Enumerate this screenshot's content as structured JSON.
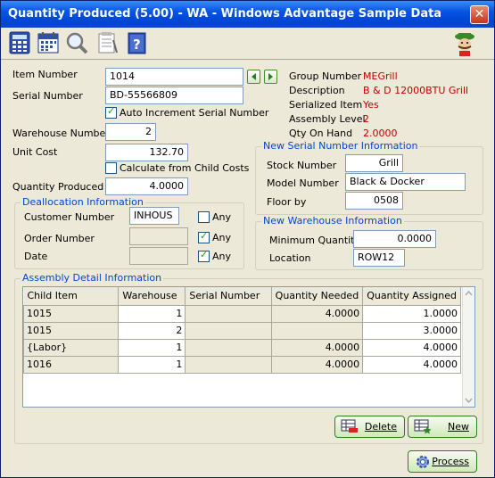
{
  "window": {
    "title": "Quantity Produced (5.00) - WA - Windows Advantage Sample Data",
    "close_glyph": "✕"
  },
  "toolbar": {
    "icons": [
      "calculator-icon",
      "calendar-icon",
      "search-icon",
      "notes-icon",
      "help-icon",
      "mascot-icon"
    ]
  },
  "form": {
    "item_number_label": "Item Number",
    "item_number": "1014",
    "serial_number_label": "Serial Number",
    "serial_number": "BD-55566809",
    "auto_increment_label": "Auto Increment Serial Number",
    "warehouse_label": "Warehouse Number",
    "warehouse": "2",
    "unit_cost_label": "Unit Cost",
    "unit_cost": "132.70",
    "calc_child_label": "Calculate from Child Costs",
    "qty_produced_label": "Quantity Produced",
    "qty_produced": "4.0000"
  },
  "info": {
    "group_label": "Group Number",
    "group": "MEGrill",
    "desc_label": "Description",
    "desc": "B & D 12000BTU Grill",
    "serialized_label": "Serialized Item",
    "serialized": "Yes",
    "assembly_label": "Assembly Level",
    "assembly": "2",
    "qoh_label": "Qty On Hand",
    "qoh": "2.0000"
  },
  "dealloc": {
    "title": "Deallocation Information",
    "customer_label": "Customer Number",
    "customer": "INHOUS",
    "order_label": "Order Number",
    "order": "",
    "date_label": "Date",
    "date": "",
    "any_label": "Any"
  },
  "serial_info": {
    "title": "New Serial Number Information",
    "stock_label": "Stock Number",
    "stock": "Grill",
    "model_label": "Model Number",
    "model": "Black & Docker",
    "floor_label": "Floor by",
    "floor": "0508"
  },
  "wh_info": {
    "title": "New Warehouse Information",
    "minqty_label": "Minimum Quantity",
    "minqty": "0.0000",
    "location_label": "Location",
    "location": "ROW12"
  },
  "assembly": {
    "title": "Assembly Detail Information",
    "columns": [
      "Child Item",
      "Warehouse",
      "Serial Number",
      "Quantity Needed",
      "Quantity Assigned"
    ],
    "rows": [
      [
        "1015",
        "1",
        "",
        "4.0000",
        "1.0000"
      ],
      [
        "1015",
        "2",
        "",
        "",
        "3.0000"
      ],
      [
        "{Labor}",
        "1",
        "",
        "4.0000",
        "4.0000"
      ],
      [
        "1016",
        "1",
        "",
        "4.0000",
        "4.0000"
      ]
    ]
  },
  "buttons": {
    "delete": "Delete",
    "new": "New",
    "process": "Process"
  }
}
